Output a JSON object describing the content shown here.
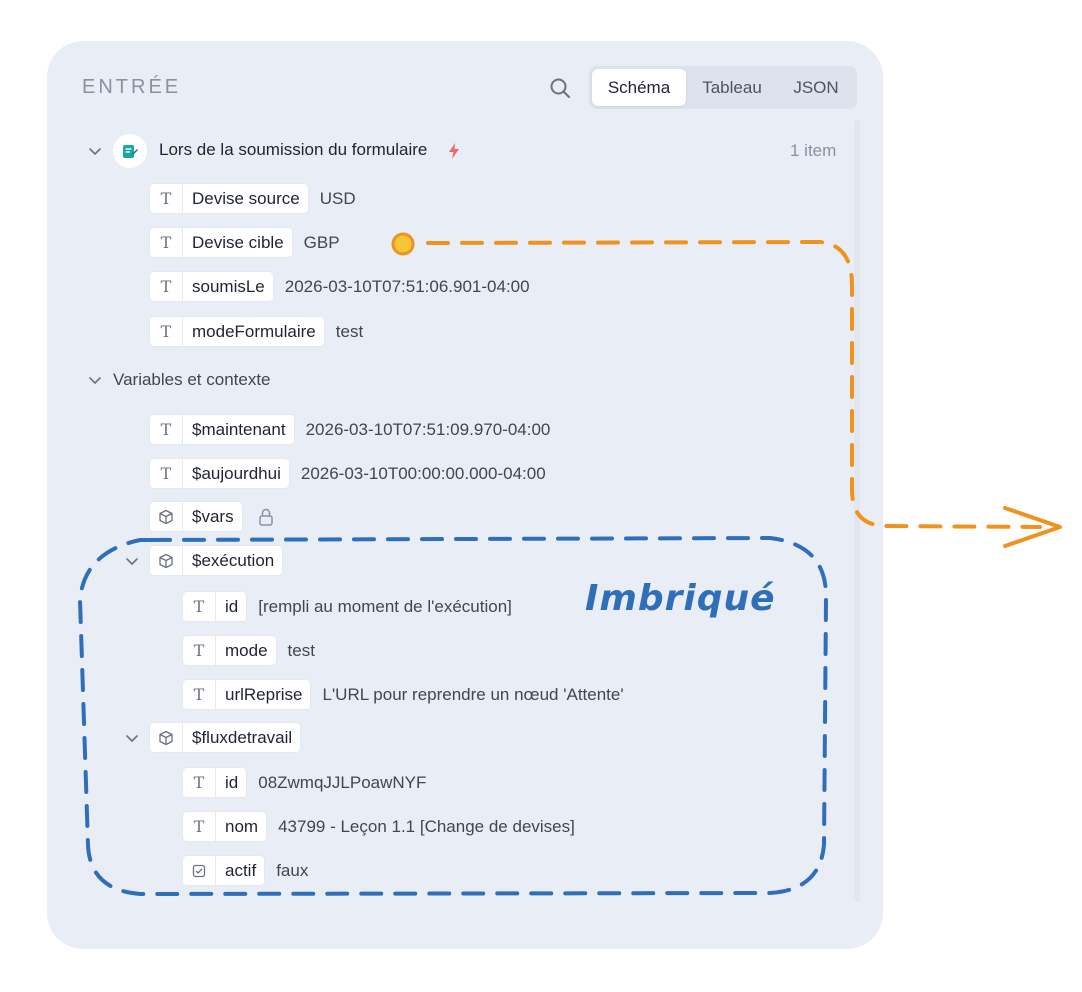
{
  "panel": {
    "title": "ENTRÉE",
    "tabs": [
      "Schéma",
      "Tableau",
      "JSON"
    ],
    "active_tab": "Schéma"
  },
  "trigger": {
    "label": "Lors de la soumission du formulaire",
    "count": "1 item",
    "fields": [
      {
        "key": "Devise source",
        "value": "USD"
      },
      {
        "key": "Devise cible",
        "value": "GBP"
      },
      {
        "key": "soumisLe",
        "value": "2026-03-10T07:51:06.901-04:00"
      },
      {
        "key": "modeFormulaire",
        "value": "test"
      }
    ]
  },
  "variables": {
    "label": "Variables et contexte",
    "items": [
      {
        "key": "$maintenant",
        "value": "2026-03-10T07:51:09.970-04:00"
      },
      {
        "key": "$aujourdhui",
        "value": "2026-03-10T00:00:00.000-04:00"
      },
      {
        "key": "$vars",
        "value": ""
      }
    ],
    "execution": {
      "key": "$exécution",
      "fields": [
        {
          "key": "id",
          "value": "[rempli au moment de l'exécution]"
        },
        {
          "key": "mode",
          "value": "test"
        },
        {
          "key": "urlReprise",
          "value": "L'URL pour reprendre un nœud 'Attente'"
        }
      ]
    },
    "workflow": {
      "key": "$fluxdetravail",
      "fields": [
        {
          "key": "id",
          "value": "08ZwmqJJLPoawNYF"
        },
        {
          "key": "nom",
          "value": "43799 - Leçon 1.1 [Change de devises]"
        },
        {
          "key": "actif",
          "value": "faux"
        }
      ]
    }
  },
  "annotation": {
    "label": "Imbriqué",
    "colors": {
      "nested": "#2f6fba",
      "arrow": "#f0921e"
    }
  },
  "icons": {
    "search": "search-icon",
    "chevron": "chevron-down-icon",
    "trigger": "form-trigger-icon",
    "bolt": "bolt-icon",
    "string": "text-type-icon",
    "object": "cube-icon",
    "boolean": "checkbox-type-icon",
    "lock": "lock-icon"
  }
}
